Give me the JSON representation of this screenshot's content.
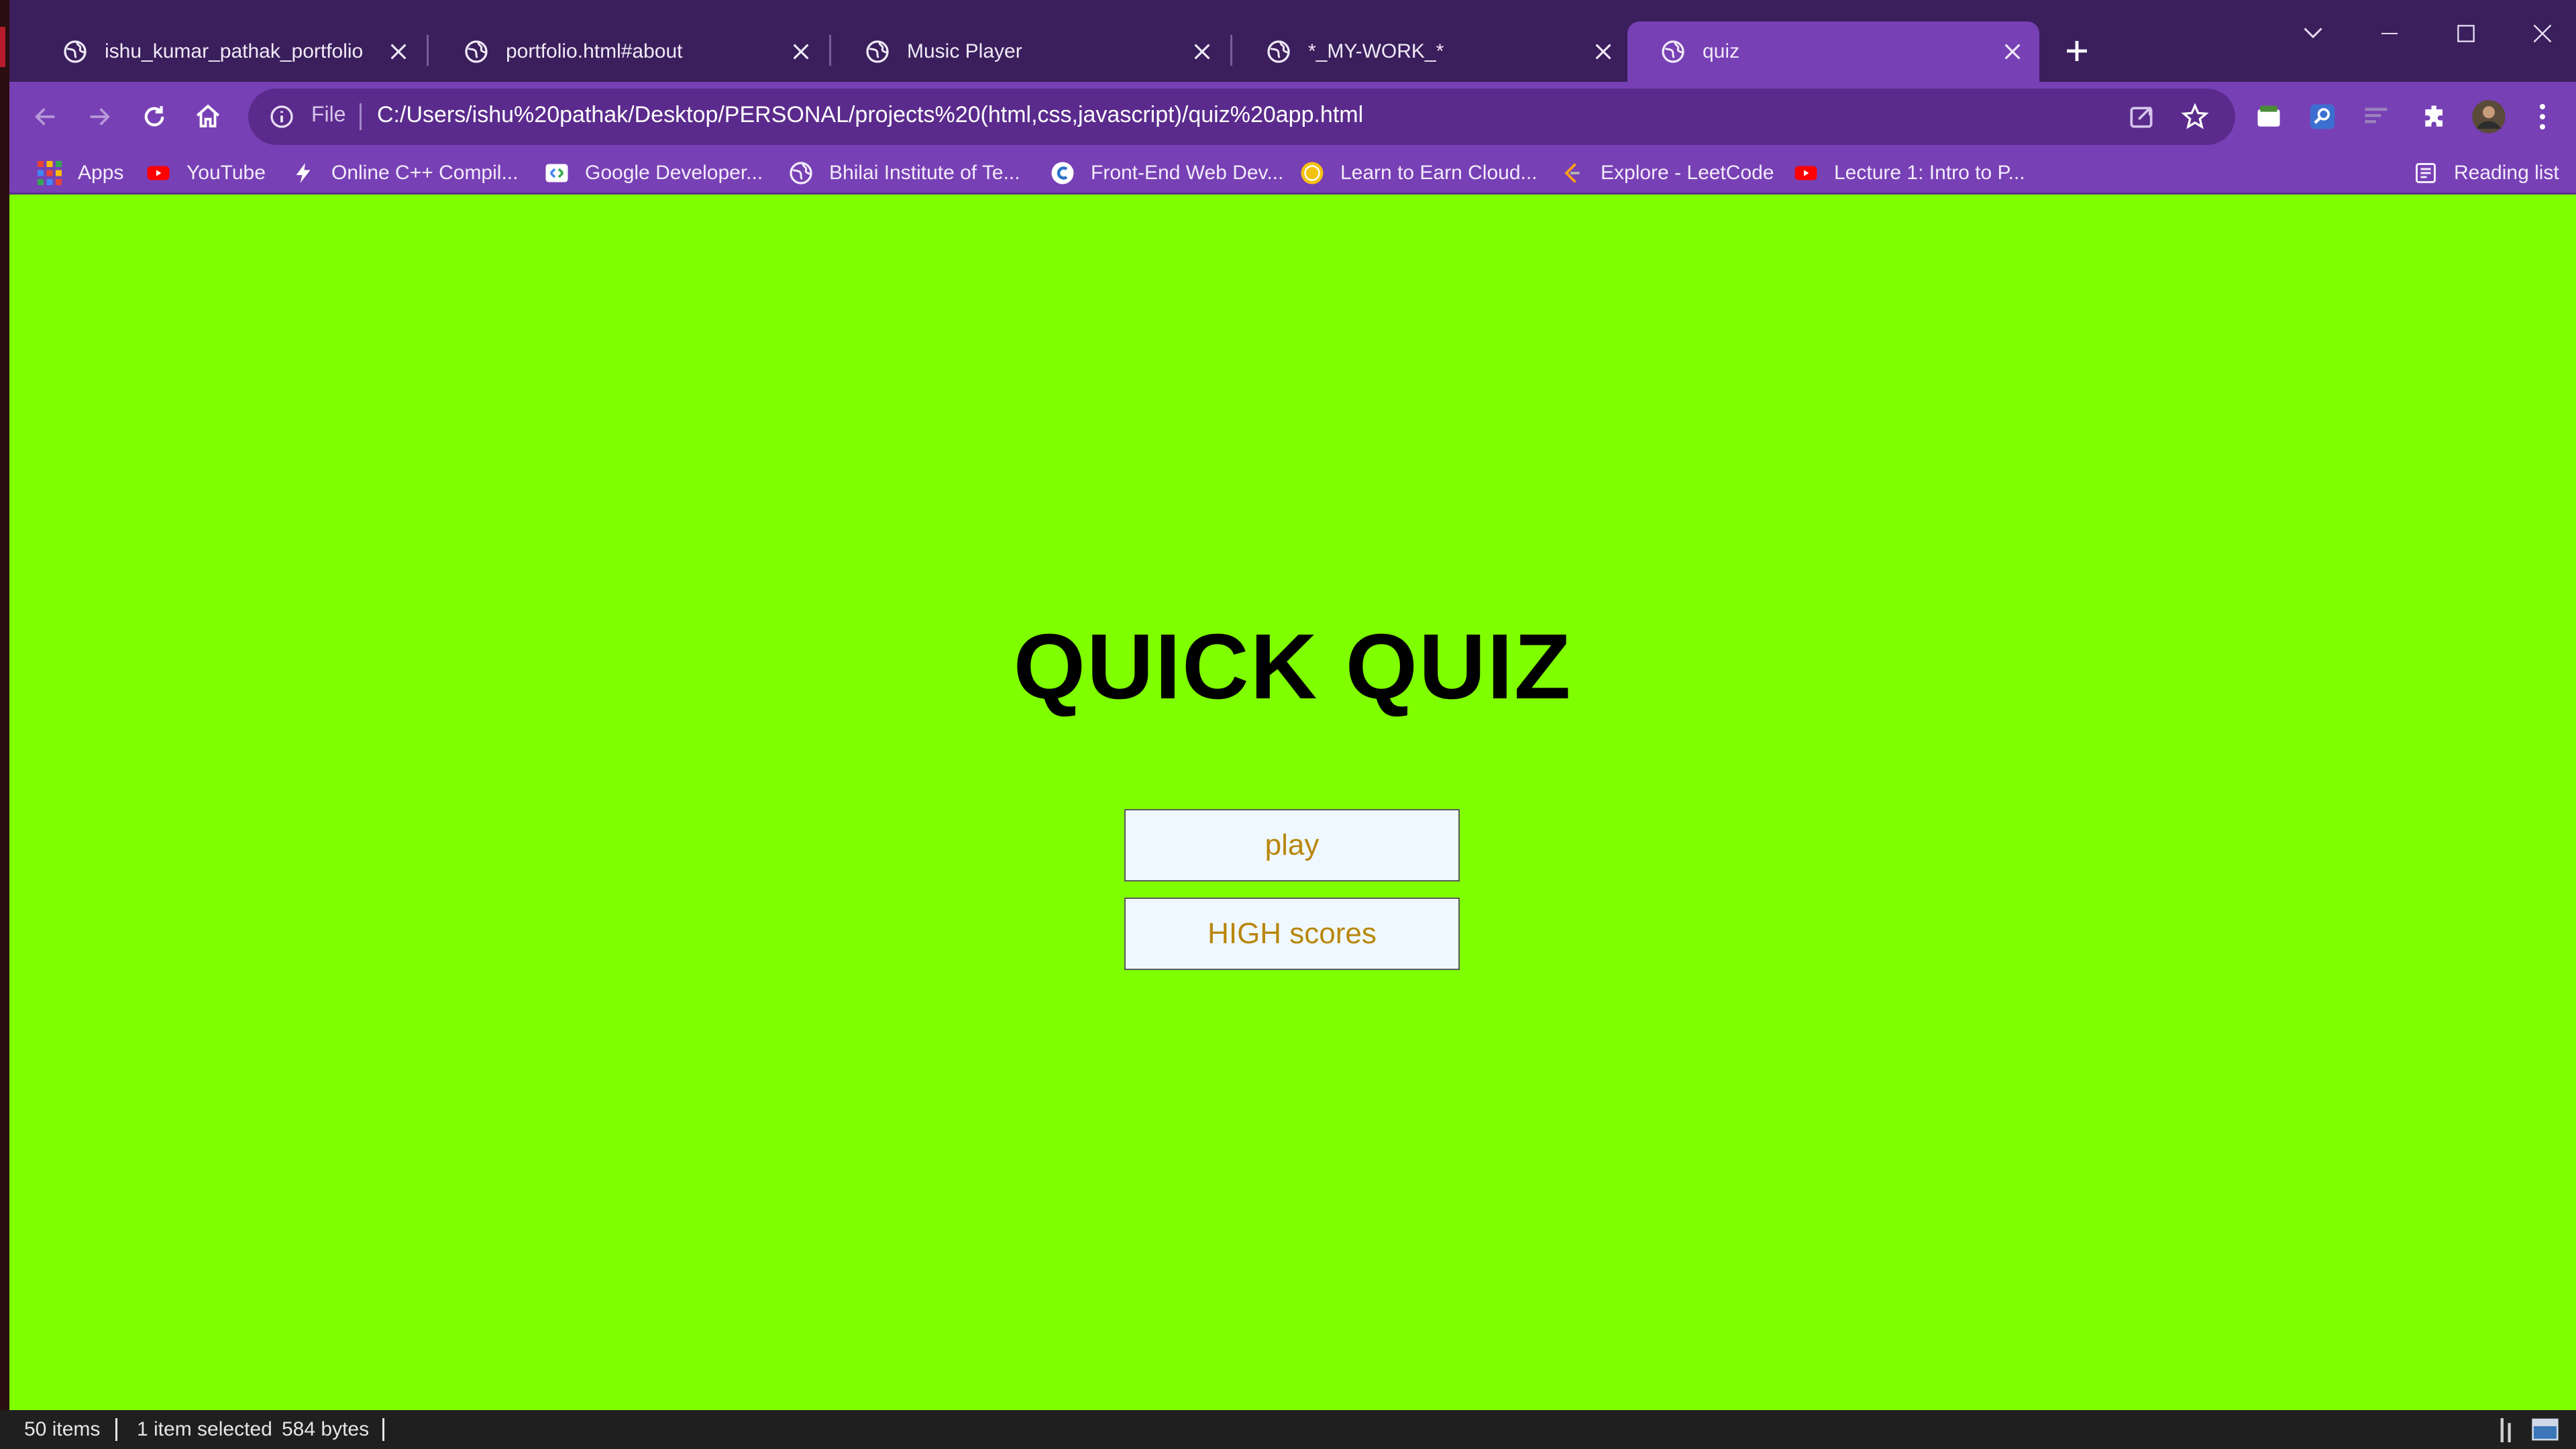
{
  "browser": {
    "tabs": [
      {
        "title": "ishu_kumar_pathak_portfolio"
      },
      {
        "title": "portfolio.html#about"
      },
      {
        "title": "Music Player"
      },
      {
        "title": "*_MY-WORK_*"
      },
      {
        "title": "quiz"
      }
    ],
    "active_tab_index": 4,
    "address": {
      "scheme": "File",
      "url": "C:/Users/ishu%20pathak/Desktop/PERSONAL/projects%20(html,css,javascript)/quiz%20app.html"
    },
    "bookmarks": [
      {
        "label": "Apps",
        "icon": "apps-grid-icon"
      },
      {
        "label": "YouTube",
        "icon": "youtube-icon"
      },
      {
        "label": "Online C++ Compil...",
        "icon": "lightning-icon"
      },
      {
        "label": "Google Developer...",
        "icon": "google-developers-icon"
      },
      {
        "label": "Bhilai Institute of Te...",
        "icon": "globe-icon"
      },
      {
        "label": "Front-End Web Dev...",
        "icon": "coursera-icon"
      },
      {
        "label": "Learn to Earn Cloud...",
        "icon": "coin-icon"
      },
      {
        "label": "Explore - LeetCode",
        "icon": "leetcode-icon"
      },
      {
        "label": "Lecture 1: Intro to P...",
        "icon": "youtube-icon"
      }
    ],
    "reading_list": "Reading list"
  },
  "page": {
    "title": "QUICK QUIZ",
    "play_label": "play",
    "highscores_label": "HIGH scores",
    "background": "#7fff00",
    "button_text_color": "#b8860b"
  },
  "status_bar": {
    "items": "50 items",
    "selected": "1 item selected",
    "size": "584 bytes"
  }
}
